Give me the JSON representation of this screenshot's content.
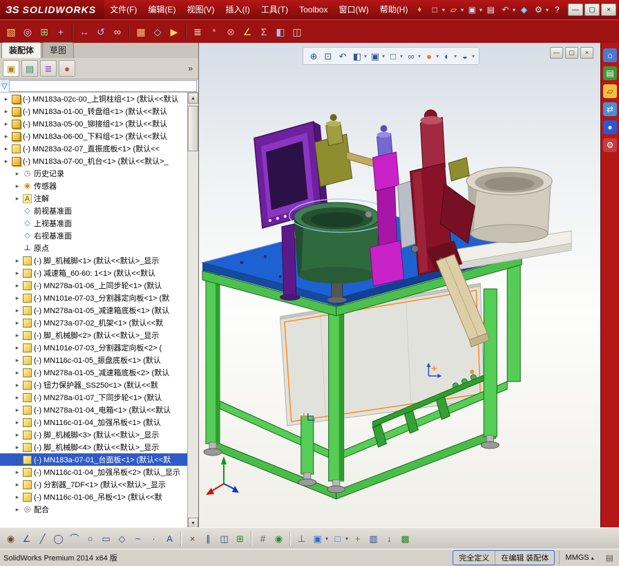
{
  "colors": {
    "red-dark": "#7e0b0b",
    "red": "#9e1212",
    "red-bright": "#b51616",
    "panel": "#d6d2ca",
    "sel": "#2e5bc7",
    "accent-orange": "#ff8a1a"
  },
  "ui": {
    "dropdown_glyph": "▾",
    "expand_glyph": "▸",
    "overflow_glyph": "»",
    "units_dropdown_glyph": "▴",
    "scroll_up_glyph": "▲",
    "scroll_down_glyph": "▼",
    "pin_glyph": "♦",
    "funnel_glyph": "▽",
    "note_icon_glyph": "▤"
  },
  "window": {
    "logo_prefix": "ЗS",
    "app_title": "SOLIDWORKS"
  },
  "menubar": {
    "items": [
      "文件(F)",
      "编辑(E)",
      "视图(V)",
      "插入(I)",
      "工具(T)",
      "Toolbox",
      "窗口(W)",
      "帮助(H)"
    ]
  },
  "window_controls": [
    {
      "name": "minimize-button",
      "glyph": "—"
    },
    {
      "name": "maximize-button",
      "glyph": "▢"
    },
    {
      "name": "close-button",
      "glyph": "×"
    }
  ],
  "quick_access": [
    {
      "name": "new-document-button",
      "glyph": "□",
      "fg": "#ffffff",
      "dropdown": true
    },
    {
      "name": "open-button",
      "glyph": "▱",
      "fg": "#ffd24a",
      "dropdown": true
    },
    {
      "name": "save-button",
      "glyph": "▣",
      "fg": "#cfe0ff",
      "dropdown": true
    },
    {
      "name": "print-button",
      "glyph": "▤",
      "fg": "#e8e8e8"
    },
    {
      "name": "undo-button",
      "glyph": "↶",
      "fg": "#cfe0ff",
      "dropdown": true
    },
    {
      "name": "rebuild-button",
      "glyph": "◆",
      "fg": "#7ad0ff"
    },
    {
      "name": "options-button",
      "glyph": "⚙",
      "fg": "#e8e8e8",
      "dropdown": true
    },
    {
      "name": "help-button",
      "glyph": "?",
      "fg": "#ffffff"
    }
  ],
  "assembly_toolbar": [
    {
      "name": "insert-components-button",
      "glyph": "▧",
      "fg": "#ffd76a"
    },
    {
      "name": "mate-button",
      "glyph": "◎",
      "fg": "#cfd6ff"
    },
    {
      "name": "linear-component-pattern-button",
      "glyph": "⊞",
      "fg": "#8ae08a"
    },
    {
      "name": "smart-fasteners-button",
      "glyph": "+",
      "fg": "#b8c8ff"
    },
    {
      "sep": true
    },
    {
      "name": "move-component-button",
      "glyph": "↔",
      "fg": "#9ac4ff"
    },
    {
      "name": "rotate-component-button",
      "glyph": "↺",
      "fg": "#9ac4ff"
    },
    {
      "name": "show-hidden-components-button",
      "glyph": "∞",
      "fg": "#e8e8e8"
    },
    {
      "sep": true
    },
    {
      "name": "assembly-features-button",
      "glyph": "▦",
      "fg": "#ffc87a"
    },
    {
      "name": "reference-geometry-button",
      "glyph": "◇",
      "fg": "#7ae0e0"
    },
    {
      "name": "new-motion-study-button",
      "glyph": "▶",
      "fg": "#ffd76a"
    },
    {
      "sep": true
    },
    {
      "name": "bill-of-materials-button",
      "glyph": "≣",
      "fg": "#e8e8c8"
    },
    {
      "name": "exploded-view-button",
      "glyph": "*",
      "fg": "#ff9a6a"
    },
    {
      "name": "interference-detection-button",
      "glyph": "⊗",
      "fg": "#ff8a8a"
    },
    {
      "name": "measure-button",
      "glyph": "∠",
      "fg": "#e8e870"
    },
    {
      "name": "mass-properties-button",
      "glyph": "Σ",
      "fg": "#d8d8d8"
    },
    {
      "name": "section-view-button",
      "glyph": "◧",
      "fg": "#9ac4ff"
    },
    {
      "name": "screen-capture-button",
      "glyph": "◫",
      "fg": "#d8d8d8"
    }
  ],
  "left_panel": {
    "command_tabs": [
      {
        "label": "装配体",
        "active": true
      },
      {
        "label": "草图",
        "active": false
      }
    ],
    "manager_tabs": [
      {
        "name": "featuremanager-tab",
        "glyph": "▣",
        "fg": "#b8860b"
      },
      {
        "name": "propertymanager-tab",
        "glyph": "▤",
        "fg": "#2a8a6a"
      },
      {
        "name": "configurationmanager-tab",
        "glyph": "≣",
        "fg": "#8a4ad0"
      },
      {
        "name": "displaymanager-tab",
        "glyph": "●",
        "fg": "#d04040"
      }
    ],
    "tree": {
      "icon_styles": {
        "asm": {
          "bg": "linear-gradient(135deg,#ffe486,#e2a92a)",
          "border": "#8a6a10",
          "shadow": "1.5px 1.5px 0 #c79a12"
        },
        "part": {
          "bg": "linear-gradient(135deg,#fdf0a6,#e8c23e)",
          "border": "#9a7a1a"
        },
        "history": {
          "glyph": "◷",
          "fg": "#7a7a7a"
        },
        "sensor": {
          "glyph": "◉",
          "fg": "#d88a10"
        },
        "ann": {
          "glyph": "A",
          "fg": "#a87808",
          "bg": "#fdf4c8",
          "border": "#c8a838"
        },
        "plane": {
          "glyph": "◇",
          "fg": "#1a90b0"
        },
        "origin": {
          "glyph": "⊥",
          "fg": "#2255cc"
        },
        "mates": {
          "glyph": "◎",
          "fg": "#6a6a6a"
        }
      },
      "items": [
        {
          "label": "(-) MN183a-02c-00_上铜柱组<1> (默认<<默认",
          "icon": "asm",
          "indent": 0,
          "arrow": true
        },
        {
          "label": "(-) MN183a-01-00_转盘组<1> (默认<<默认",
          "icon": "asm",
          "indent": 0,
          "arrow": true
        },
        {
          "label": "(-) MN183a-05-00_铆接组<1> (默认<<默认",
          "icon": "asm",
          "indent": 0,
          "arrow": true
        },
        {
          "label": "(-) MN183a-06-00_下料组<1> (默认<<默认",
          "icon": "asm",
          "indent": 0,
          "arrow": true
        },
        {
          "label": "(-) MN283a-02-07_直振底板<1> (默认<<",
          "icon": "part",
          "indent": 0,
          "arrow": true
        },
        {
          "label": "(-) MN183a-07-00_机台<1> (默认<<默认>_",
          "icon": "asm",
          "indent": 0,
          "arrow": true
        },
        {
          "label": "历史记录",
          "icon": "history",
          "indent": 1,
          "arrow": true
        },
        {
          "label": "传感器",
          "icon": "sensor",
          "indent": 1,
          "arrow": true
        },
        {
          "label": "注解",
          "icon": "ann",
          "indent": 1,
          "arrow": true
        },
        {
          "label": "前视基准面",
          "icon": "plane",
          "indent": 1,
          "arrow": false
        },
        {
          "label": "上视基准面",
          "icon": "plane",
          "indent": 1,
          "arrow": false
        },
        {
          "label": "右视基准面",
          "icon": "plane",
          "indent": 1,
          "arrow": false
        },
        {
          "label": "原点",
          "icon": "origin",
          "indent": 1,
          "arrow": false
        },
        {
          "label": "(-) 脚_机械脚<1> (默认<<默认>_显示",
          "icon": "part",
          "indent": 1,
          "arrow": true
        },
        {
          "label": "(-) 减速箱_60-60: 1<1> (默认<<默认",
          "icon": "part",
          "indent": 1,
          "arrow": true
        },
        {
          "label": "(-) MN278a-01-06_上同步轮<1> (默认",
          "icon": "part",
          "indent": 1,
          "arrow": true
        },
        {
          "label": "(-) MN101e-07-03_分割器定向板<1> (默",
          "icon": "part",
          "indent": 1,
          "arrow": true
        },
        {
          "label": "(-) MN278a-01-05_减速箱底板<1> (默认",
          "icon": "part",
          "indent": 1,
          "arrow": true
        },
        {
          "label": "(-) MN273a-07-02_机架<1> (默认<<默",
          "icon": "part",
          "indent": 1,
          "arrow": true
        },
        {
          "label": "(-) 脚_机械脚<2> (默认<<默认>_显示",
          "icon": "part",
          "indent": 1,
          "arrow": true
        },
        {
          "label": "(-) MN101e-07-03_分割器定向板<2> (",
          "icon": "part",
          "indent": 1,
          "arrow": true
        },
        {
          "label": "(-) MN116c-01-05_振盘底板<1> (默认",
          "icon": "part",
          "indent": 1,
          "arrow": true
        },
        {
          "label": "(-) MN278a-01-05_减速箱底板<2> (默认",
          "icon": "part",
          "indent": 1,
          "arrow": true
        },
        {
          "label": "(-) 钮力保护器_SS250<1> (默认<<默",
          "icon": "part",
          "indent": 1,
          "arrow": true
        },
        {
          "label": "(-) MN278a-01-07_下同步轮<1> (默认",
          "icon": "part",
          "indent": 1,
          "arrow": true
        },
        {
          "label": "(-) MN278a-01-04_电箱<1> (默认<<默认",
          "icon": "part",
          "indent": 1,
          "arrow": true
        },
        {
          "label": "(-) MN116c-01-04_加强吊板<1> (默认",
          "icon": "part",
          "indent": 1,
          "arrow": true
        },
        {
          "label": "(-) 脚_机械脚<3> (默认<<默认>_显示",
          "icon": "part",
          "indent": 1,
          "arrow": true
        },
        {
          "label": "(-) 脚_机械脚<4> (默认<<默认>_显示",
          "icon": "part",
          "indent": 1,
          "arrow": true
        },
        {
          "label": "(-) MN183a-07-01_台面板<1> (默认<<默",
          "icon": "part",
          "indent": 1,
          "arrow": true,
          "selected": true
        },
        {
          "label": "(-) MN116c-01-04_加强吊板<2> (默认_显示",
          "icon": "part",
          "indent": 1,
          "arrow": true
        },
        {
          "label": "(-) 分割器_7DF<1> (默认<<默认>_显示",
          "icon": "part",
          "indent": 1,
          "arrow": true
        },
        {
          "label": "(-) MN116c-01-06_吊板<1> (默认<<默",
          "icon": "part",
          "indent": 1,
          "arrow": true
        },
        {
          "label": "配合",
          "icon": "mates",
          "indent": 1,
          "arrow": true
        }
      ]
    }
  },
  "viewport": {
    "toolbar": [
      {
        "name": "zoom-fit-button",
        "glyph": "⊕"
      },
      {
        "name": "zoom-area-button",
        "glyph": "⊡"
      },
      {
        "name": "previous-view-button",
        "glyph": "↶"
      },
      {
        "name": "section-view-button",
        "glyph": "◧",
        "dropdown": true
      },
      {
        "name": "view-orientation-button",
        "glyph": "▣",
        "dropdown": true
      },
      {
        "name": "display-style-button",
        "glyph": "□",
        "dropdown": true
      },
      {
        "name": "hide-show-items-button",
        "glyph": "∞",
        "dropdown": true
      },
      {
        "name": "edit-appearance-button",
        "glyph": "●",
        "fg": "#e07a30",
        "dropdown": true
      },
      {
        "name": "apply-scene-button",
        "glyph": "◐",
        "dropdown": true
      },
      {
        "name": "view-settings-button",
        "glyph": "◒",
        "dropdown": true
      }
    ],
    "doc_controls": [
      {
        "name": "viewport-minimize-button",
        "glyph": "—"
      },
      {
        "name": "viewport-restore-button",
        "glyph": "▢"
      },
      {
        "name": "viewport-close-button",
        "glyph": "×"
      }
    ]
  },
  "task_pane": [
    {
      "name": "resources-home-icon",
      "glyph": "⌂",
      "fg": "#ffffff",
      "bg": "#4a7ad0"
    },
    {
      "name": "design-library-icon",
      "glyph": "▤",
      "fg": "#ffffff",
      "bg": "#3a9a3a"
    },
    {
      "name": "file-explorer-icon",
      "glyph": "▱",
      "fg": "#6a4a10",
      "bg": "#f0c040"
    },
    {
      "name": "view-palette-icon",
      "glyph": "⇄",
      "fg": "#ffffff",
      "bg": "#4a90d8"
    },
    {
      "name": "appearances-icon",
      "glyph": "●",
      "fg": "#cfe4ff",
      "bg": "#2a5ad0"
    },
    {
      "name": "custom-properties-icon",
      "glyph": "⚙",
      "fg": "#ffffff",
      "bg": "#c04040"
    }
  ],
  "sketch_toolbar": [
    {
      "name": "sketch-button",
      "glyph": "◉",
      "fg": "#6a4a2a"
    },
    {
      "name": "smart-dimension-button",
      "glyph": "∠",
      "fg": "#2a4a8a"
    },
    {
      "name": "line-button",
      "glyph": "╱",
      "fg": "#2a4a8a"
    },
    {
      "name": "circle-button",
      "glyph": "◯",
      "fg": "#2a4a8a"
    },
    {
      "name": "arc-button",
      "glyph": "⌒",
      "fg": "#2a4a8a"
    },
    {
      "name": "ellipse-button",
      "glyph": "○",
      "fg": "#2a4a8a"
    },
    {
      "name": "rectangle-button",
      "glyph": "▭",
      "fg": "#2a4a8a"
    },
    {
      "name": "polygon-button",
      "glyph": "◇",
      "fg": "#2a4a8a"
    },
    {
      "name": "spline-button",
      "glyph": "~",
      "fg": "#2a4a8a"
    },
    {
      "name": "point-button",
      "glyph": "·",
      "fg": "#2a4a8a"
    },
    {
      "name": "text-button",
      "glyph": "A",
      "fg": "#2a4a8a"
    },
    {
      "sep": true
    },
    {
      "name": "trim-entities-button",
      "glyph": "×",
      "fg": "#8a2a2a"
    },
    {
      "name": "offset-entities-button",
      "glyph": "∥",
      "fg": "#2a4a8a"
    },
    {
      "name": "mirror-entities-button",
      "glyph": "◫",
      "fg": "#2a4a8a"
    },
    {
      "name": "linear-sketch-pattern-button",
      "glyph": "⊞",
      "fg": "#2a8a2a"
    },
    {
      "sep": true
    },
    {
      "name": "grid-snap-button",
      "glyph": "#",
      "fg": "#555555"
    },
    {
      "name": "sketch-snaps-button",
      "glyph": "◉",
      "fg": "#2a8a2a"
    },
    {
      "sep": true
    },
    {
      "name": "normal-to-button",
      "glyph": "⊥",
      "fg": "#2a4a8a"
    },
    {
      "name": "view-planes-button",
      "glyph": "▣",
      "fg": "#2a6ad0",
      "dropdown": true
    },
    {
      "name": "shaded-view-button",
      "glyph": "□",
      "fg": "#2a6ad0",
      "dropdown": true
    },
    {
      "name": "insert-entity-button",
      "glyph": "+",
      "fg": "#2a8a2a"
    },
    {
      "name": "window-select-button",
      "glyph": "▥",
      "fg": "#2a4a8a"
    },
    {
      "name": "anchor-button",
      "glyph": "↓",
      "fg": "#2a4a8a"
    },
    {
      "name": "pattern-grid-button",
      "glyph": "▩",
      "fg": "#2a8a2a"
    }
  ],
  "statusbar": {
    "left_text": "SolidWorks Premium 2014 x64 版",
    "define_state": "完全定义",
    "edit_state": "在编辑 装配体",
    "units": "MMGS"
  }
}
